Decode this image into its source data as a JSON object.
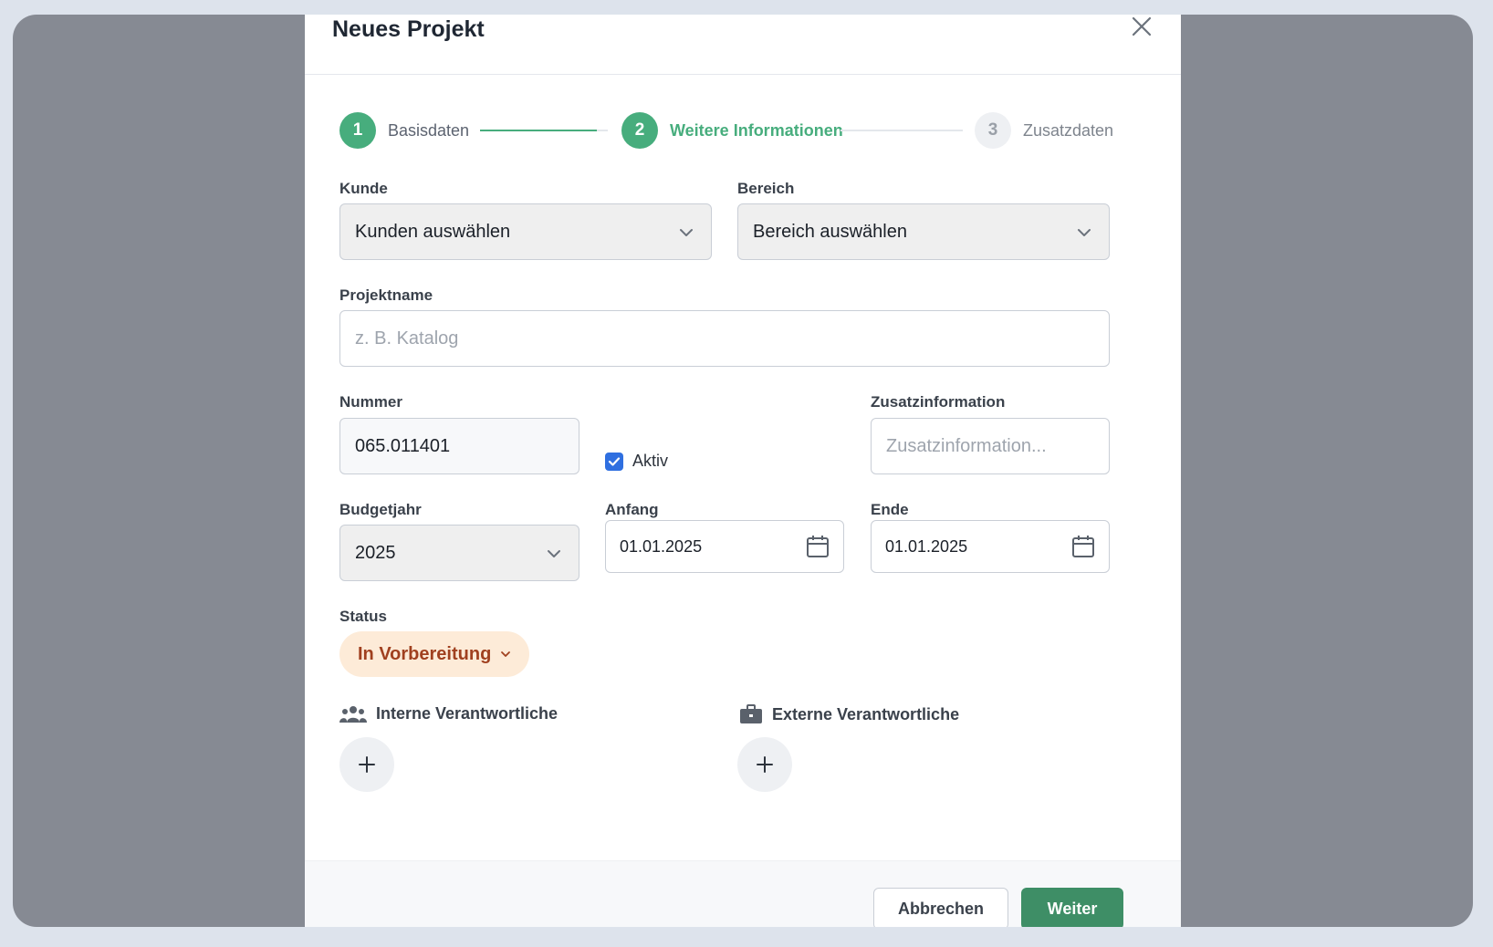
{
  "modal": {
    "title": "Neues Projekt"
  },
  "steps": [
    {
      "number": "1",
      "label": "Basisdaten",
      "state": "done"
    },
    {
      "number": "2",
      "label": "Weitere Informationen",
      "state": "active"
    },
    {
      "number": "3",
      "label": "Zusatzdaten",
      "state": "todo"
    }
  ],
  "form": {
    "kunde": {
      "label": "Kunde",
      "value": "Kunden auswählen"
    },
    "bereich": {
      "label": "Bereich",
      "value": "Bereich auswählen"
    },
    "projektname": {
      "label": "Projektname",
      "placeholder": "z. B. Katalog",
      "value": ""
    },
    "nummer": {
      "label": "Nummer",
      "value": "065.011401"
    },
    "aktiv": {
      "label": "Aktiv",
      "checked": true
    },
    "zusatzinformation": {
      "label": "Zusatzinformation",
      "placeholder": "Zusatzinformation...",
      "value": ""
    },
    "budgetjahr": {
      "label": "Budgetjahr",
      "value": "2025"
    },
    "anfang": {
      "label": "Anfang",
      "value": "01.01.2025"
    },
    "ende": {
      "label": "Ende",
      "value": "01.01.2025"
    },
    "status": {
      "label": "Status",
      "value": "In Vorbereitung"
    }
  },
  "responsibles": {
    "internal": {
      "label": "Interne Verantwortliche",
      "icon": "users-icon"
    },
    "external": {
      "label": "Externe Verantwortliche",
      "icon": "briefcase-icon"
    }
  },
  "footer": {
    "cancel_label": "Abbrechen",
    "next_label": "Weiter"
  },
  "colors": {
    "accent": "#47ad7d",
    "primary_button": "#3e8e66",
    "status_bg": "#fdebd8",
    "status_text": "#a0401f",
    "checkbox": "#2f6fe0"
  }
}
